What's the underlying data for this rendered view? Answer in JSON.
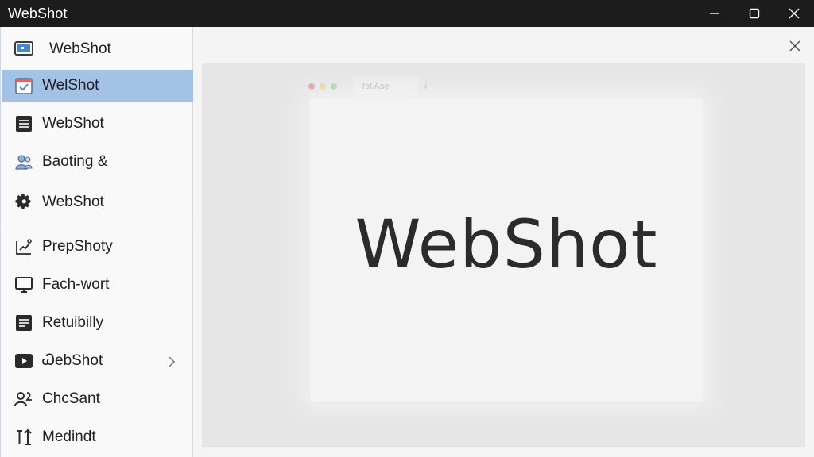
{
  "window": {
    "title": "WebShot",
    "controls": [
      "minimize-icon",
      "maximize-icon",
      "close-icon"
    ]
  },
  "sidebar": {
    "items": [
      {
        "label": "WebShot",
        "icon": "app-window-icon",
        "state": "header"
      },
      {
        "label": "WelShot",
        "icon": "calendar-icon",
        "state": "selected"
      },
      {
        "label": "WebShot",
        "icon": "document-list-icon"
      },
      {
        "label": "Baoting &",
        "icon": "users-icon"
      },
      {
        "label": "WebShot",
        "icon": "gear-icon",
        "underlined": true
      },
      {
        "label": "PrepShoty",
        "icon": "edit-chart-icon"
      },
      {
        "label": "Fach-wort",
        "icon": "monitor-icon"
      },
      {
        "label": "Retuibilly",
        "icon": "notes-icon"
      },
      {
        "label": "WebShot",
        "icon": "play-icon",
        "has_chevron": true,
        "display": "ᏇebShot"
      },
      {
        "label": "ChcSant",
        "icon": "people-icon"
      },
      {
        "label": "Medindt",
        "icon": "sort-icon"
      }
    ],
    "accent_color": "#a4c2e6"
  },
  "preview": {
    "tab_text": "Tst Ase",
    "heading": "WebShot",
    "traffic_lights": [
      "#e06c6c",
      "#e8c46a",
      "#7cc47a"
    ]
  }
}
